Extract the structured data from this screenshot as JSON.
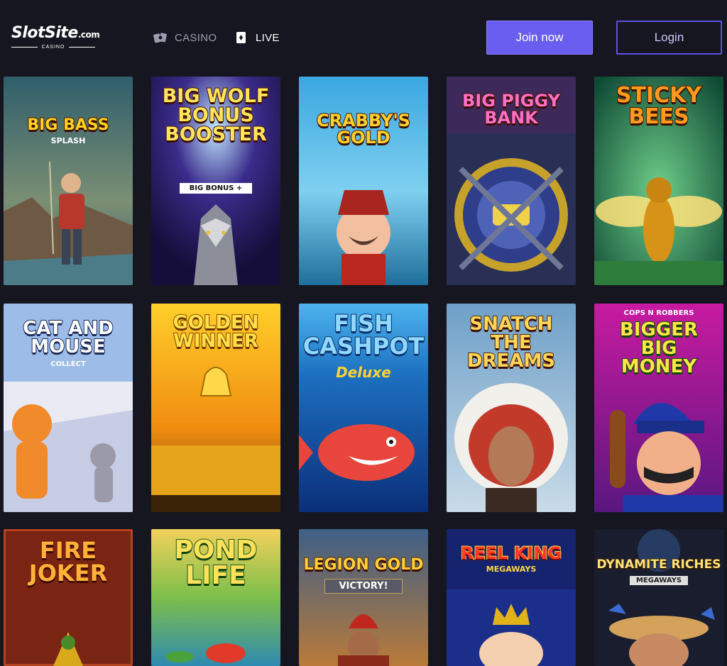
{
  "brand": {
    "name": "SlotSite",
    "domain": ".com",
    "tagline": "CASINO"
  },
  "nav": [
    {
      "label": "CASINO",
      "icon": "cards-icon"
    },
    {
      "label": "LIVE",
      "icon": "playing-card-icon"
    }
  ],
  "actions": {
    "join_label": "Join now",
    "login_label": "Login"
  },
  "colors": {
    "background": "#15161f",
    "accent": "#6a5ef0",
    "login_border": "#5d52e0"
  },
  "games": [
    {
      "title": "BIG BASS",
      "subtitle": "SPLASH"
    },
    {
      "title": "BIG WOLF BONUS BOOSTER",
      "subtitle": "BIG BONUS +"
    },
    {
      "title": "CRABBY'S GOLD",
      "subtitle": ""
    },
    {
      "title": "BIG PIGGY BANK",
      "subtitle": ""
    },
    {
      "title": "STICKY BEES",
      "subtitle": ""
    },
    {
      "title": "CAT AND MOUSE",
      "subtitle": "COLLECT"
    },
    {
      "title": "GOLDEN WINNER",
      "subtitle": ""
    },
    {
      "title": "FISH CASHPOT",
      "subtitle": "Deluxe"
    },
    {
      "title": "SNATCH THE DREAMS",
      "subtitle": ""
    },
    {
      "title": "BIGGER BIG MONEY",
      "subtitle": "COPS N ROBBERS"
    },
    {
      "title": "FIRE JOKER",
      "subtitle": ""
    },
    {
      "title": "POND LIFE",
      "subtitle": ""
    },
    {
      "title": "LEGION GOLD",
      "subtitle": "VICTORY!"
    },
    {
      "title": "REEL KING",
      "subtitle": "MEGAWAYS"
    },
    {
      "title": "DYNAMITE RICHES",
      "subtitle": "MEGAWAYS"
    }
  ]
}
